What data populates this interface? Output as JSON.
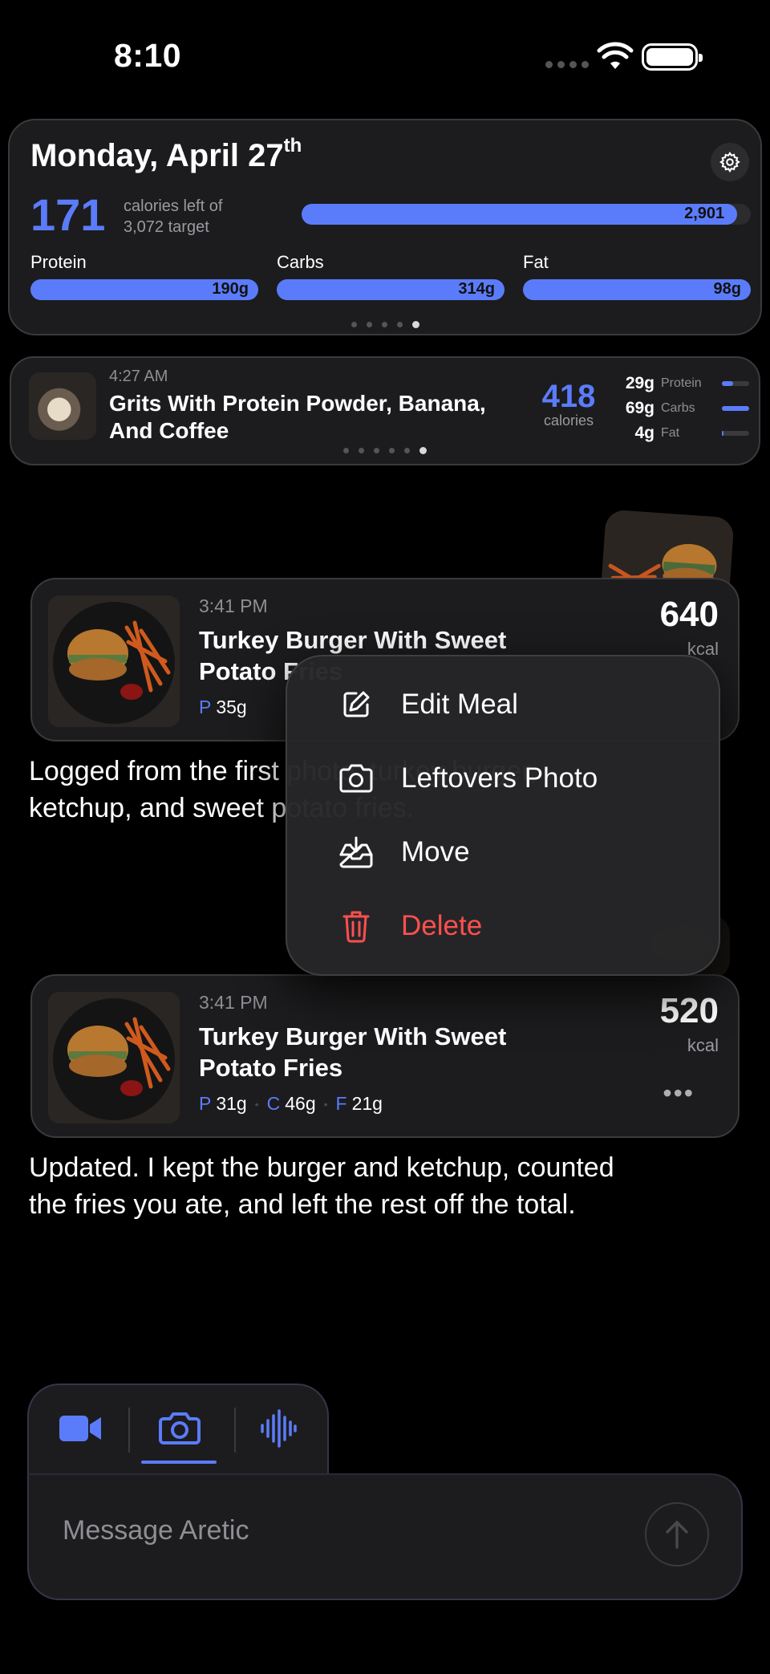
{
  "status": {
    "time": "8:10"
  },
  "summary": {
    "date_main": "Monday, April 27",
    "date_suffix": "th",
    "calories_left": "171",
    "calories_left_label_1": "calories left of",
    "calories_left_label_2": "3,072 target",
    "calories_eaten": "2,901",
    "calories_progress": 0.97,
    "macros": [
      {
        "label": "Protein",
        "value": "190g",
        "progress": 1.0
      },
      {
        "label": "Carbs",
        "value": "314g",
        "progress": 1.0
      },
      {
        "label": "Fat",
        "value": "98g",
        "progress": 1.0
      }
    ],
    "page_count": 5,
    "page_index": 4
  },
  "last_meal": {
    "time": "4:27 AM",
    "name": "Grits With Protein Powder, Banana, And Coffee",
    "calories": "418",
    "calories_label": "calories",
    "macros": [
      {
        "value": "29g",
        "label": "Protein",
        "progress": 0.4
      },
      {
        "value": "69g",
        "label": "Carbs",
        "progress": 1.0
      },
      {
        "value": "4g",
        "label": "Fat",
        "progress": 0.05
      }
    ],
    "page_count": 6,
    "page_index": 5
  },
  "meal_1": {
    "time": "3:41 PM",
    "name": "Turkey Burger With Sweet Potato Fries",
    "protein_key": "P",
    "protein": "35g",
    "kcal": "640",
    "kcal_label": "kcal"
  },
  "message_1": "Logged from the first photo: turkey burger, ketchup, and sweet potato fries.",
  "context_menu": {
    "items": [
      {
        "label": "Edit Meal",
        "icon": "edit-icon"
      },
      {
        "label": "Leftovers Photo",
        "icon": "camera-icon"
      },
      {
        "label": "Move",
        "icon": "tray-icon"
      },
      {
        "label": "Delete",
        "icon": "trash-icon",
        "color": "#ff4f4f"
      }
    ]
  },
  "meal_2": {
    "time": "3:41 PM",
    "name": "Turkey Burger With Sweet Potato Fries",
    "protein_key": "P",
    "protein": "31g",
    "carbs_key": "C",
    "carbs": "46g",
    "fat_key": "F",
    "fat": "21g",
    "kcal": "520",
    "kcal_label": "kcal",
    "more": "•••"
  },
  "message_2": "Updated. I kept the burger and ketchup, counted the fries you ate, and left the rest off the total.",
  "composer": {
    "placeholder": "Message Aretic",
    "modes": [
      "video-icon",
      "camera-icon",
      "waveform-icon"
    ],
    "active_mode": "camera-icon"
  },
  "colors": {
    "accent": "#5b7cfa",
    "danger": "#ff4f4f",
    "background": "#000000",
    "card": "#1c1c1e"
  }
}
